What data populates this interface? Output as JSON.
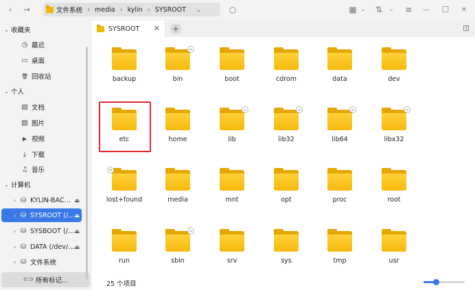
{
  "toolbar": {
    "back_icon": "‹",
    "forward_icon": "→",
    "search_icon": "○",
    "breadcrumbs": [
      "文件系统",
      "media",
      "kylin",
      "SYSROOT"
    ],
    "view_icon": "▦",
    "sort_icon": "⇅",
    "menu_icon": "≡",
    "minimize_icon": "—",
    "maximize_icon": "☐",
    "close_icon": "✕",
    "chevron": "⌄"
  },
  "sidebar": {
    "favorites": {
      "label": "收藏夹",
      "items": [
        {
          "label": "最近",
          "icon": "◷"
        },
        {
          "label": "桌面",
          "icon": "▭"
        },
        {
          "label": "回收站",
          "icon": "🗑"
        }
      ]
    },
    "personal": {
      "label": "个人",
      "items": [
        {
          "label": "文档",
          "icon": "▤"
        },
        {
          "label": "图片",
          "icon": "▨"
        },
        {
          "label": "视频",
          "icon": "▶"
        },
        {
          "label": "下载",
          "icon": "⤓"
        },
        {
          "label": "音乐",
          "icon": "♫"
        }
      ]
    },
    "computer": {
      "label": "计算机",
      "items": [
        {
          "label": "KYLIN-BAC…",
          "active": false
        },
        {
          "label": "SYSROOT (/…",
          "active": true
        },
        {
          "label": "SYSBOOT (/…",
          "active": false
        },
        {
          "label": "DATA (/dev/…",
          "active": false
        },
        {
          "label": "文件系统",
          "active": false
        }
      ]
    },
    "tags_button": "所有标记..."
  },
  "tab": {
    "title": "SYSROOT",
    "close": "✕",
    "add": "+"
  },
  "files": [
    {
      "name": "backup",
      "link": false,
      "locked": false
    },
    {
      "name": "bin",
      "link": true,
      "locked": false
    },
    {
      "name": "boot",
      "link": false,
      "locked": false
    },
    {
      "name": "cdrom",
      "link": false,
      "locked": false
    },
    {
      "name": "data",
      "link": false,
      "locked": false
    },
    {
      "name": "dev",
      "link": false,
      "locked": false
    },
    {
      "name": "etc",
      "link": false,
      "locked": false
    },
    {
      "name": "home",
      "link": false,
      "locked": false
    },
    {
      "name": "lib",
      "link": true,
      "locked": false
    },
    {
      "name": "lib32",
      "link": true,
      "locked": false
    },
    {
      "name": "lib64",
      "link": true,
      "locked": false
    },
    {
      "name": "libx32",
      "link": true,
      "locked": false
    },
    {
      "name": "lost+found",
      "link": false,
      "locked": true
    },
    {
      "name": "media",
      "link": false,
      "locked": false
    },
    {
      "name": "mnt",
      "link": false,
      "locked": false
    },
    {
      "name": "opt",
      "link": false,
      "locked": false
    },
    {
      "name": "proc",
      "link": false,
      "locked": false
    },
    {
      "name": "root",
      "link": false,
      "locked": false
    },
    {
      "name": "run",
      "link": false,
      "locked": false
    },
    {
      "name": "sbin",
      "link": true,
      "locked": false
    },
    {
      "name": "srv",
      "link": false,
      "locked": false
    },
    {
      "name": "sys",
      "link": false,
      "locked": false
    },
    {
      "name": "tmp",
      "link": false,
      "locked": false
    },
    {
      "name": "usr",
      "link": false,
      "locked": false
    }
  ],
  "status": {
    "count": "25 个项目",
    "zoom_fraction": 0.3
  },
  "colors": {
    "accent": "#3b78e7",
    "highlight": "#e1262a",
    "folder": "#f7b90c"
  }
}
